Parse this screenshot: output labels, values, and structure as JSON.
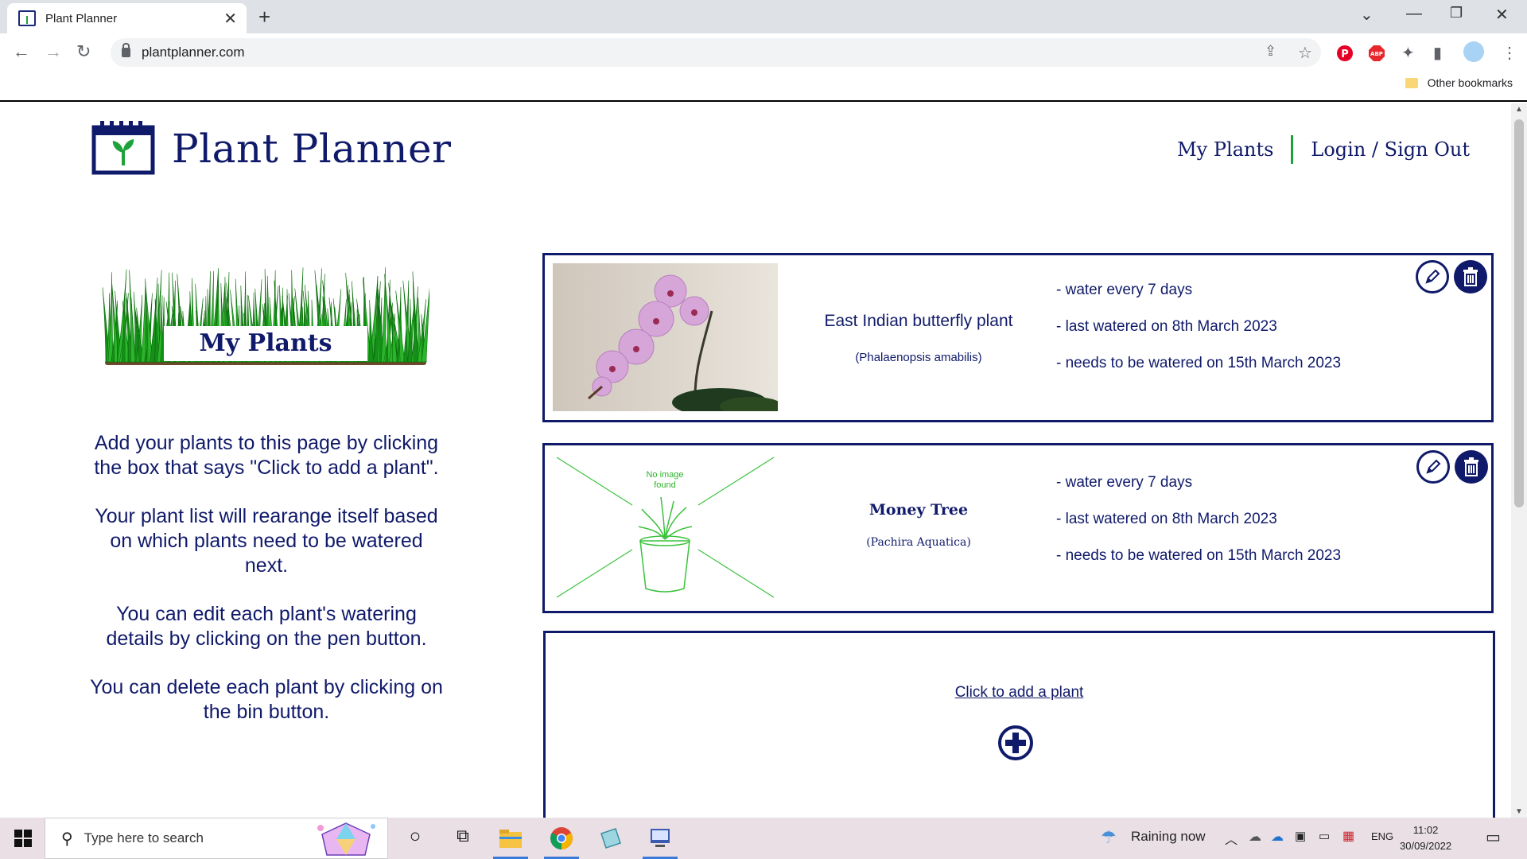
{
  "browser": {
    "tab_title": "Plant Planner",
    "url": "plantplanner.com",
    "bookmarks_other": "Other bookmarks"
  },
  "site": {
    "title": "Plant Planner",
    "nav": {
      "my_plants": "My Plants",
      "login": "Login / Sign Out"
    },
    "sidebar": {
      "banner": "My Plants",
      "instructions": [
        "Add your plants to this page by clicking the box that says \"Click to add a plant\".",
        "Your plant list will rearange itself based on which plants need to be watered next.",
        "You can edit each plant's watering details by clicking on the pen button.",
        "You can delete each plant by clicking on the bin button."
      ]
    },
    "plants": [
      {
        "name": "East Indian butterfly plant",
        "scientific": "(Phalaenopsis amabilis)",
        "water_every": "- water every 7 days",
        "last_watered": "- last watered on 8th March 2023",
        "next_water": "- needs to be watered on 15th March 2023"
      },
      {
        "name": "Money Tree",
        "scientific": "(Pachira Aquatica)",
        "no_image": "No image found",
        "water_every": "- water every 7 days",
        "last_watered": "- last watered on 8th March 2023",
        "next_water": "- needs to be watered on 15th March 2023"
      }
    ],
    "add_plant": "Click to add a plant"
  },
  "taskbar": {
    "search_placeholder": "Type here to search",
    "weather": "Raining now",
    "lang": "ENG",
    "time": "11:02",
    "date": "30/09/2022"
  },
  "colors": {
    "brand_navy": "#101a6a",
    "brand_green": "#1ea33a"
  }
}
